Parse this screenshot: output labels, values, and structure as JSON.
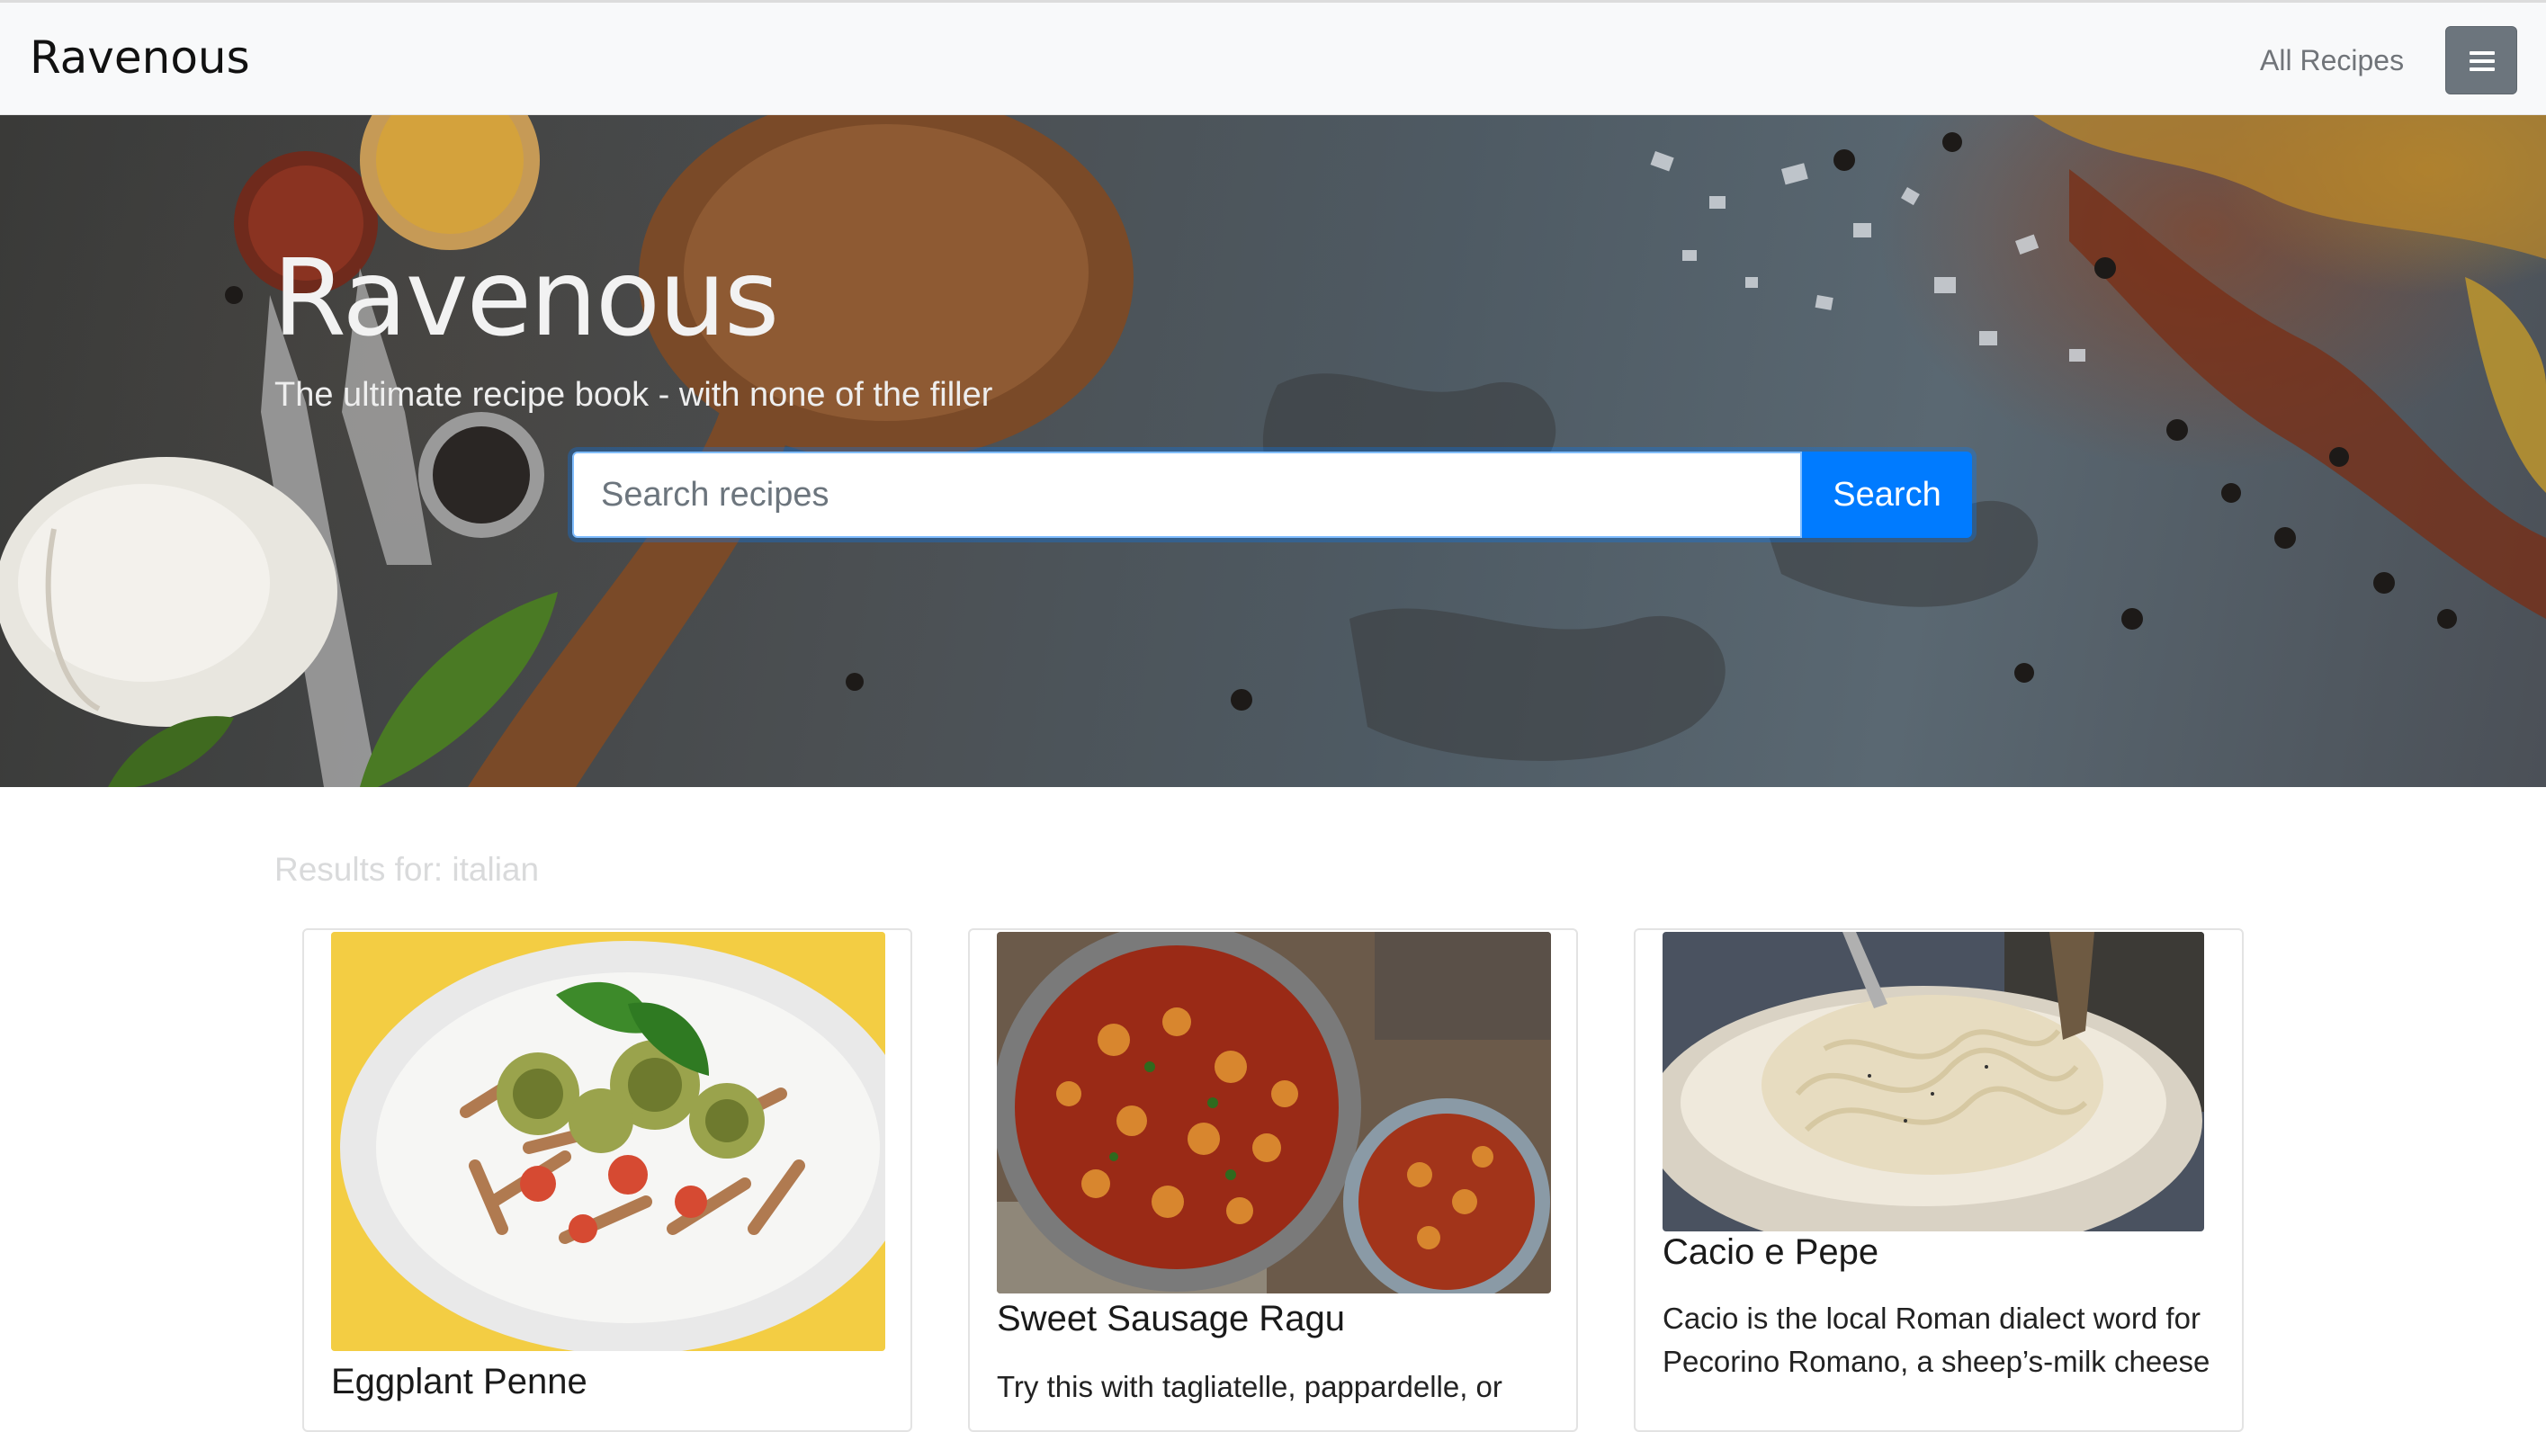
{
  "navbar": {
    "brand": "Ravenous",
    "all_recipes_link": "All Recipes",
    "menu_icon": "hamburger-icon"
  },
  "hero": {
    "title": "Ravenous",
    "subtitle": "The ultimate recipe book - with none of the filler",
    "search_placeholder": "Search recipes",
    "search_button": "Search"
  },
  "results": {
    "label": "Results for: italian",
    "cards": [
      {
        "title": "Eggplant Penne",
        "description": ""
      },
      {
        "title": "Sweet Sausage Ragu",
        "description": "Try this with tagliatelle, pappardelle, or"
      },
      {
        "title": "Cacio e Pepe",
        "description": "Cacio is the local Roman dialect word for Pecorino Romano, a sheep’s-milk cheese"
      }
    ]
  },
  "colors": {
    "primary": "#007bff",
    "navbar_bg": "#f8f9fa",
    "toggler_bg": "#6c757d"
  }
}
